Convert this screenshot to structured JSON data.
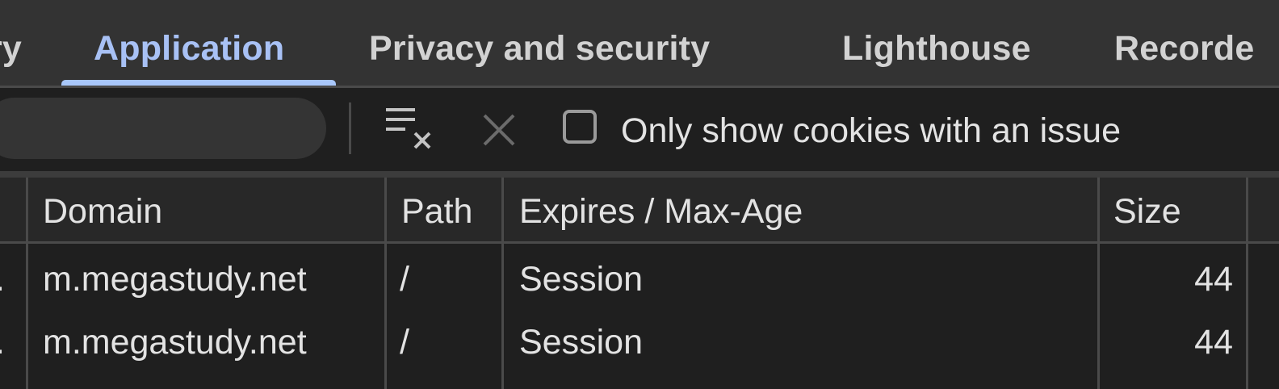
{
  "tabs": [
    {
      "label": "ry",
      "active": false
    },
    {
      "label": "Application",
      "active": true
    },
    {
      "label": "Privacy and security",
      "active": false
    },
    {
      "label": "Lighthouse",
      "active": false
    },
    {
      "label": "Recorde",
      "active": false
    }
  ],
  "toolbar": {
    "filter_value": "",
    "clear_icon": "clear-all-icon",
    "delete_icon": "delete-x-icon",
    "issue_checkbox_checked": false,
    "issue_label": "Only show cookies with an issue"
  },
  "table": {
    "columns": [
      "Domain",
      "Path",
      "Expires / Max-Age",
      "Size"
    ],
    "rows": [
      {
        "name_fragment": ".",
        "domain": "m.megastudy.net",
        "path": "/",
        "expires": "Session",
        "size": "44"
      },
      {
        "name_fragment": ".",
        "domain": "m.megastudy.net",
        "path": "/",
        "expires": "Session",
        "size": "44"
      }
    ]
  },
  "colors": {
    "active_tab": "#a8c1f5",
    "underline": "#a8c7fa",
    "background": "#1f1f1f"
  }
}
